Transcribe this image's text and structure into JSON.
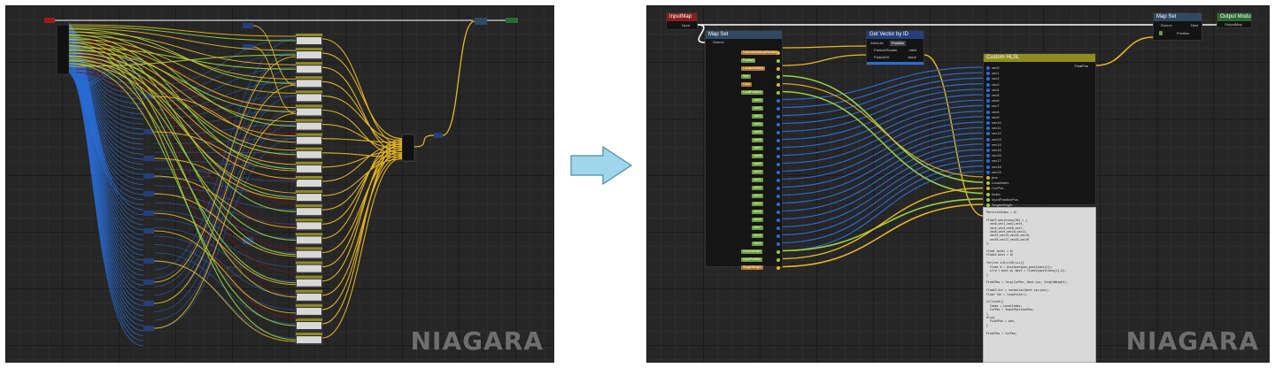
{
  "watermark": "NIAGARA",
  "right_graph": {
    "input_node": {
      "title": "InputMap",
      "pin": "Input"
    },
    "map_set_1": {
      "title": "Map Set",
      "pin": "Source",
      "inputs": [
        "ParticlesAttributeReader",
        "Position",
        "LocalizedValue",
        "Size",
        "Color",
        "LocalPosition",
        "Var01",
        "Var02",
        "Var03",
        "Var04",
        "Var05",
        "Var06",
        "Var07",
        "Var08",
        "Var09",
        "Var10",
        "Var11",
        "Var12",
        "Var13",
        "Var14",
        "Var15",
        "Var16",
        "Var17",
        "Var18",
        "Var19",
        "CurrentIndex",
        "InputPosition",
        "SingleWeight"
      ]
    },
    "get_vector": {
      "title": "Get Vector by ID",
      "tab_label": "Attribute",
      "tab_value": "Position",
      "in_pins": [
        "ParticleReader",
        "ParticleID"
      ],
      "out_pins": [
        "Valid",
        "Value"
      ]
    },
    "custom_hlsl": {
      "title": "Custom HLSL",
      "inputs": [
        "vec0",
        "vec1",
        "vec2",
        "vec3",
        "vec4",
        "vec5",
        "vec6",
        "vec7",
        "vec8",
        "vec9",
        "vec10",
        "vec11",
        "vec12",
        "vec13",
        "vec14",
        "vec15",
        "vec16",
        "vec17",
        "vec18",
        "vec19",
        "pos",
        "LocalIndex",
        "CurPos",
        "Index",
        "InputPositionPos",
        "SingleWeight"
      ],
      "output": "FinalPos"
    },
    "map_set_2": {
      "title": "Map Set",
      "pins": [
        "Source",
        "Position"
      ],
      "dest_label": "Dest"
    },
    "output_node": {
      "title": "Output Module",
      "pin": "OutputMap"
    },
    "code_text": "ParticleIndex = 0;\n\nfloat3 positions[20] = {\n  vec0,vec1,vec2,vec3,\n  vec4,vec5,vec6,vec7,\n  vec8,vec9,vec10,vec11,\n  vec12,vec13,vec14,vec15,\n  vec16,vec17,vec18,vec19\n};\n\nfloat total = 0;\nfloat4 best = 0;\n\nfor(int i=0;i<20;i++){\n  float d = distance(pos,positions[i]);\n  if(d < best.w) best = float4(positions[i],d);\n}\n\nFinalPos = lerp(CurPos, best.xyz, SingleWeight);\n\nfloat3 dir = normalize(best.xyz-pos);\nfloat len = length(dir);\n\nif(len>0){\n  Index = LocalIndex;\n  CurPos = InputPositionPos;\n}\nelse{\n  FinalPos = pos;\n}\n\nFinalPos = CurPos;"
  },
  "left_graph": {
    "node_count": 38
  },
  "colors": {
    "vector_wire": "#2a6dd8",
    "float_wire": "#9ad13a",
    "exec_wire": "#ffffff",
    "yellow_wire": "#e8b722",
    "red_wire": "#7a1414",
    "arrow_fill": "#9fd7ea"
  }
}
